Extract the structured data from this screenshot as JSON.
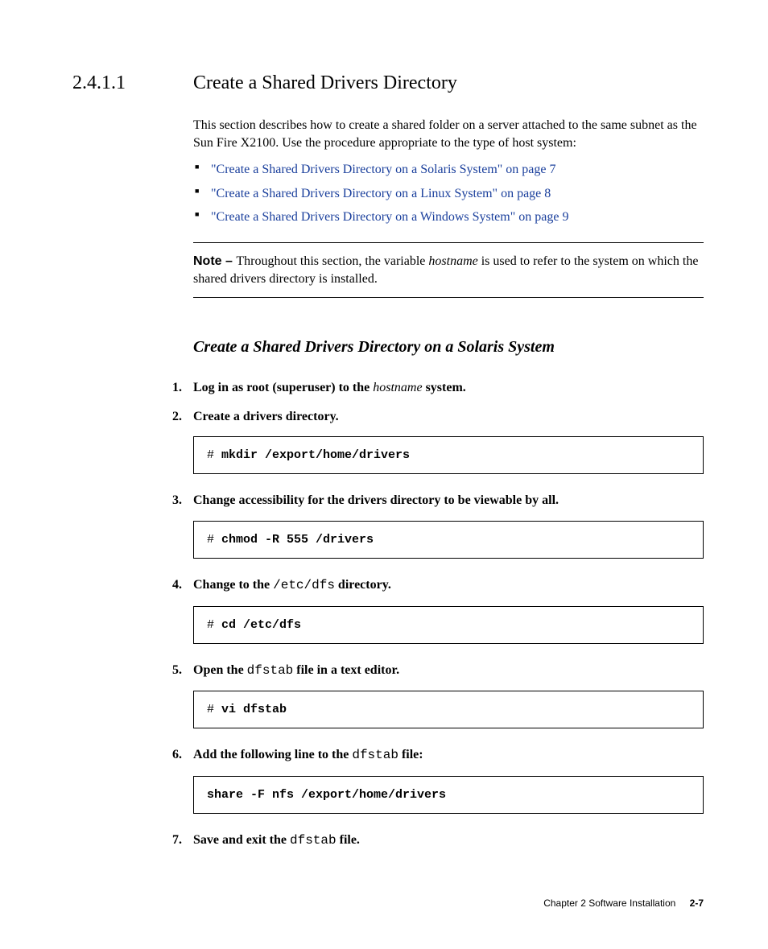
{
  "heading": {
    "number": "2.4.1.1",
    "title": "Create a Shared Drivers Directory"
  },
  "intro": "This section describes how to create a shared folder on a server attached to the same subnet as the Sun Fire X2100. Use the procedure appropriate to the type of host system:",
  "bullets": [
    "\"Create a Shared Drivers Directory on a Solaris System\" on page 7",
    "\"Create a Shared Drivers Directory on a Linux System\" on page 8",
    "\"Create a Shared Drivers Directory on a Windows System\" on page 9"
  ],
  "note": {
    "label": "Note – ",
    "before": "Throughout this section, the variable ",
    "var": "hostname",
    "after": " is used to refer to the system on which the shared drivers directory is installed."
  },
  "subheading": "Create a Shared Drivers Directory on a Solaris System",
  "steps": {
    "s1_pre": "Log in as root (superuser) to the ",
    "s1_var": "hostname",
    "s1_post": " system.",
    "s2": "Create a drivers directory.",
    "s3": "Change accessibility for the drivers directory to be viewable by all.",
    "s4_pre": "Change to the ",
    "s4_mono": "/etc/dfs",
    "s4_post": " directory.",
    "s5_pre": "Open the ",
    "s5_mono": "dfstab",
    "s5_post": " file in a text editor.",
    "s6_pre": "Add the following line to the ",
    "s6_mono": "dfstab",
    "s6_post": " file:",
    "s7_pre": "Save and exit the ",
    "s7_mono": "dfstab",
    "s7_post": " file."
  },
  "code": {
    "c1_prompt": "# ",
    "c1_cmd": "mkdir /export/home/drivers",
    "c2_prompt": "# ",
    "c2_cmd": "chmod -R 555 /drivers",
    "c3_prompt": "# ",
    "c3_cmd": "cd /etc/dfs",
    "c4_prompt": "# ",
    "c4_cmd": "vi dfstab",
    "c5_cmd": "share -F nfs /export/home/drivers"
  },
  "footer": {
    "chapter": "Chapter 2   Software Installation",
    "page": "2-7"
  }
}
